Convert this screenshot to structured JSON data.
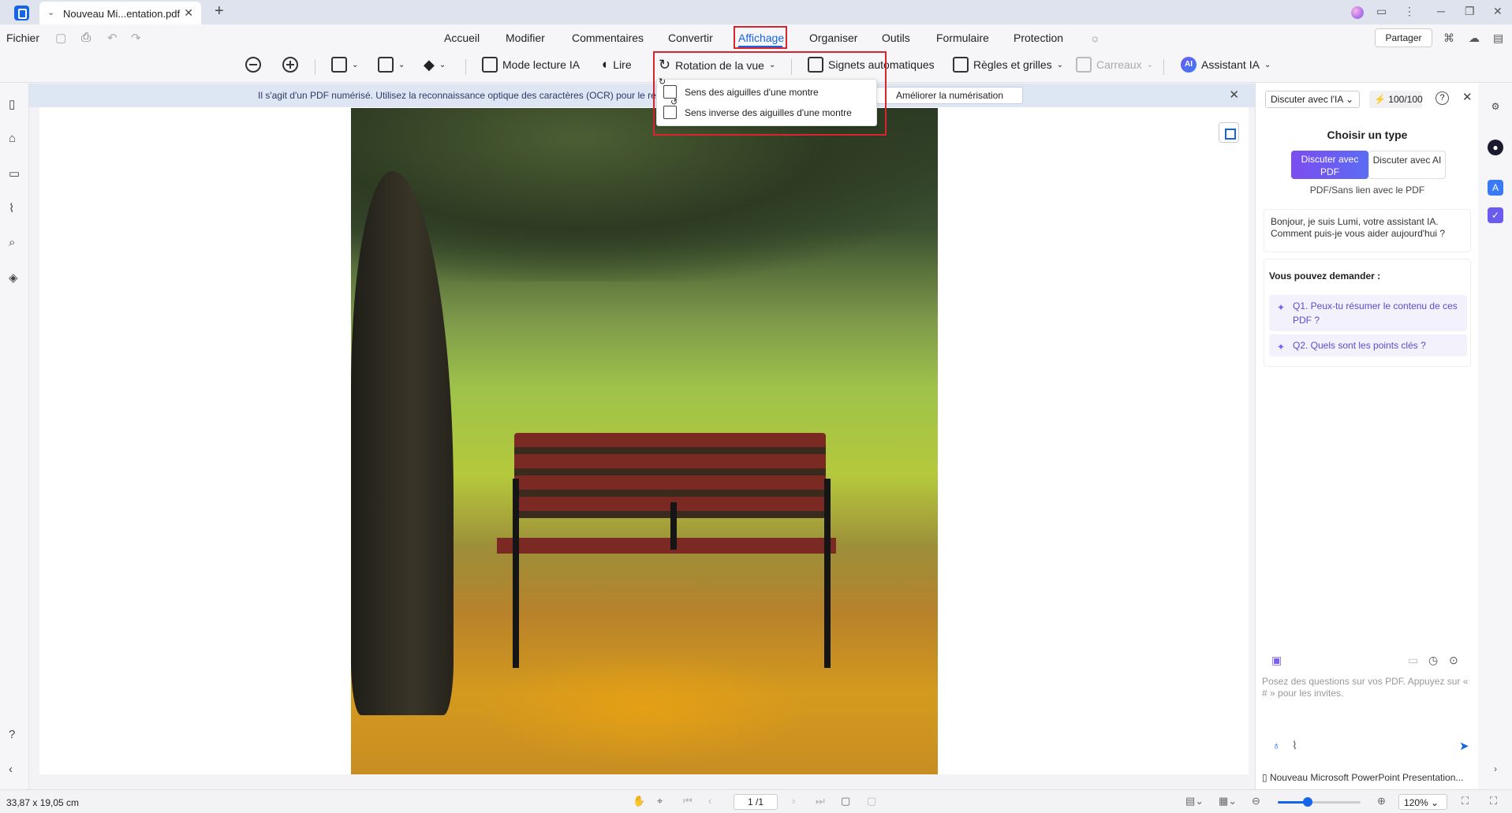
{
  "tab": {
    "title": "Nouveau Mi...entation.pdf"
  },
  "menu": {
    "file": "Fichier",
    "items": [
      "Accueil",
      "Modifier",
      "Commentaires",
      "Convertir",
      "Affichage",
      "Organiser",
      "Outils",
      "Formulaire",
      "Protection"
    ],
    "share": "Partager"
  },
  "toolbar": {
    "read_mode": "Mode lecture IA",
    "read": "Lire",
    "rotate": "Rotation de la vue",
    "bookmarks": "Signets automatiques",
    "rulers": "Règles et grilles",
    "tiles": "Carreaux",
    "assistant": "Assistant IA",
    "ai_badge": "AI"
  },
  "rotate_menu": {
    "clockwise": "Sens des aiguilles d'une montre",
    "counterclockwise": "Sens inverse des aiguilles d'une montre"
  },
  "ocr": {
    "message": "Il s'agit d'un PDF numérisé. Utilisez la reconnaissance optique des caractères (OCR) pour le rendre...",
    "button": "Améliorer la numérisation"
  },
  "ai_panel": {
    "mode_select": "Discuter avec l'IA",
    "credits": "100/100",
    "choose_type": "Choisir un type",
    "type_pdf": "Discuter avec PDF",
    "type_ai": "Discuter avec AI",
    "subtitle": "PDF/Sans lien avec le PDF",
    "greeting": "Bonjour, je suis Lumi, votre assistant IA. Comment puis-je vous aider aujourd'hui ?",
    "ask_title": "Vous pouvez demander :",
    "questions": [
      "Q1. Peux-tu résumer le contenu de ces PDF ?",
      "Q2. Quels sont les points clés ?"
    ],
    "input_placeholder": "Posez des questions sur vos PDF. Appuyez sur « # » pour les invites.",
    "file_ref": "Nouveau Microsoft PowerPoint Presentation..."
  },
  "status": {
    "dimensions": "33,87 x 19,05 cm",
    "page": "1 /1",
    "zoom": "120%",
    "zoom_level": 0.36
  },
  "colors": {
    "accent": "#1565e8",
    "highlight": "#d9232d",
    "ai_purple": "#7d4cf0"
  }
}
